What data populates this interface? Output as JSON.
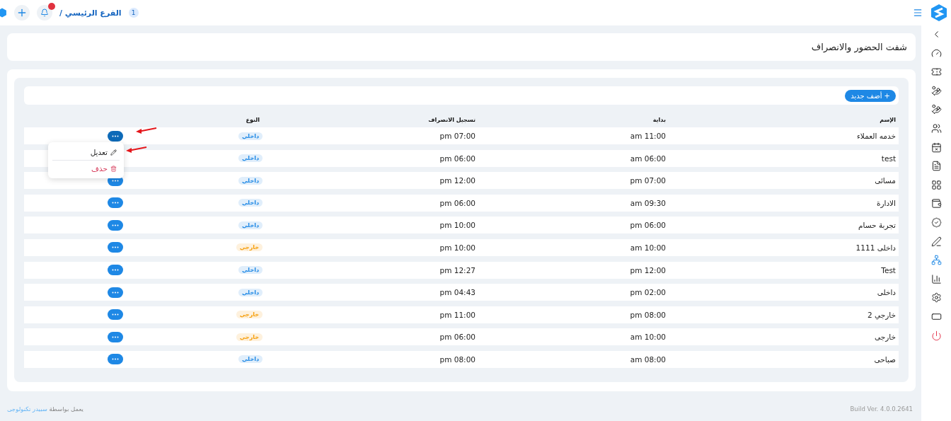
{
  "topbar": {
    "branch_number": "1",
    "branch_name": "الفرع الرئيسي /",
    "notifications": {
      "unread": true
    }
  },
  "sidebar": {
    "items": [
      {
        "selected": false
      },
      {
        "selected": false
      },
      {
        "selected": false
      },
      {
        "selected": false
      },
      {
        "selected": false
      },
      {
        "selected": false
      },
      {
        "selected": false
      },
      {
        "selected": false
      },
      {
        "selected": false
      },
      {
        "selected": false
      },
      {
        "selected": false
      },
      {
        "selected": false
      },
      {
        "selected": true
      },
      {
        "selected": false
      },
      {
        "selected": false
      },
      {
        "selected": false
      },
      {
        "selected": false
      }
    ]
  },
  "page_title": "شفت الحضور والانصراف",
  "add_button": "+ أضف جديد",
  "table": {
    "columns": [
      "الإسم",
      "بداية",
      "تسجيل الانصراف",
      "النوع"
    ],
    "rows": [
      {
        "name": "خدمه العملاء",
        "start": "11:00 am",
        "end": "07:00 pm",
        "type": {
          "label": "داخلي",
          "color": "#1e88e5"
        },
        "menu_open": true
      },
      {
        "name": "test",
        "start": "06:00 am",
        "end": "06:00 pm",
        "type": {
          "label": "داخلي",
          "color": "#1e88e5"
        },
        "menu_open": false
      },
      {
        "name": "مسائى",
        "start": "07:00 pm",
        "end": "12:00 pm",
        "type": {
          "label": "داخلي",
          "color": "#1e88e5"
        },
        "menu_open": false
      },
      {
        "name": "الادارة",
        "start": "09:30 am",
        "end": "06:00 pm",
        "type": {
          "label": "داخلي",
          "color": "#1e88e5"
        },
        "menu_open": false
      },
      {
        "name": "تجربة حسام",
        "start": "06:00 pm",
        "end": "10:00 pm",
        "type": {
          "label": "داخلي",
          "color": "#1e88e5"
        },
        "menu_open": false
      },
      {
        "name": "داخلى 1111",
        "start": "10:00 am",
        "end": "10:00 pm",
        "type": {
          "label": "خارجي",
          "color": "#f59e0b"
        },
        "menu_open": false
      },
      {
        "name": "Test",
        "start": "12:00 pm",
        "end": "12:27 pm",
        "type": {
          "label": "داخلي",
          "color": "#1e88e5"
        },
        "menu_open": false
      },
      {
        "name": "داخلى",
        "start": "02:00 pm",
        "end": "04:43 pm",
        "type": {
          "label": "داخلي",
          "color": "#1e88e5"
        },
        "menu_open": false
      },
      {
        "name": "خارجي 2",
        "start": "08:00 pm",
        "end": "11:00 pm",
        "type": {
          "label": "خارجي",
          "color": "#f59e0b"
        },
        "menu_open": false
      },
      {
        "name": "خارجى",
        "start": "10:00 am",
        "end": "06:00 pm",
        "type": {
          "label": "خارجي",
          "color": "#f59e0b"
        },
        "menu_open": false
      },
      {
        "name": "صباحى",
        "start": "08:00 am",
        "end": "08:00 pm",
        "type": {
          "label": "داخلي",
          "color": "#1e88e5"
        },
        "menu_open": false
      }
    ]
  },
  "row_menu": {
    "items": [
      {
        "kind": "edit",
        "label": "تعديل"
      },
      {
        "kind": "delete",
        "label": "حذف"
      }
    ]
  },
  "footer": {
    "build": "Build Ver. 4.0.0.2641",
    "powered_by": "يعمل بواسطة",
    "company_link": "سبيدر تكنولوجى"
  }
}
